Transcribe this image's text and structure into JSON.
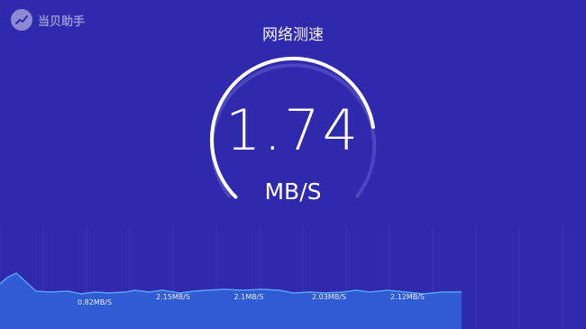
{
  "brand": {
    "name": "当贝助手",
    "logo_icon": "chart-arrow-icon"
  },
  "header": {
    "title": "网络测速"
  },
  "speed": {
    "value": "1.74",
    "unit": "MB/S",
    "gauge_progress": 0.8
  },
  "chart_data": {
    "type": "area",
    "segment_labels": [
      "0.82MB/S",
      "2.15MB/S",
      "2.1MB/S",
      "2.03MB/S",
      "2.12MB/S"
    ],
    "color": "#2f5fd6",
    "line_color": "#5aa0f5"
  }
}
